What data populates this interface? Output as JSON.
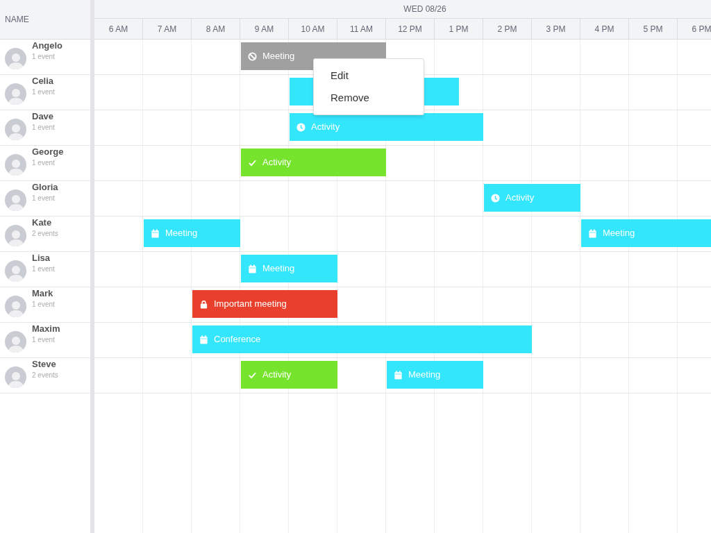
{
  "header": {
    "name_column": "NAME",
    "date": "WED 08/26",
    "hours": [
      "6 AM",
      "7 AM",
      "8 AM",
      "9 AM",
      "10 AM",
      "11 AM",
      "12 PM",
      "1 PM",
      "2 PM",
      "3 PM",
      "4 PM",
      "5 PM",
      "6 PM"
    ]
  },
  "resources": [
    {
      "name": "Angelo",
      "count": "1 event",
      "events": [
        {
          "label": "Meeting",
          "kind": "blocked",
          "color": "#a0a0a0"
        }
      ]
    },
    {
      "name": "Celia",
      "count": "1 event",
      "events": [
        {
          "kind": "hidden",
          "color": "#33e6fc"
        }
      ]
    },
    {
      "name": "Dave",
      "count": "1 event",
      "events": [
        {
          "label": "Activity",
          "kind": "clock",
          "color": "#33e6fc"
        }
      ]
    },
    {
      "name": "George",
      "count": "1 event",
      "events": [
        {
          "label": "Activity",
          "kind": "check",
          "color": "#76e42c"
        }
      ]
    },
    {
      "name": "Gloria",
      "count": "1 event",
      "events": [
        {
          "label": "Activity",
          "kind": "clock",
          "color": "#33e6fc"
        }
      ]
    },
    {
      "name": "Kate",
      "count": "2 events",
      "events": [
        {
          "label": "Meeting",
          "kind": "calendar",
          "color": "#33e6fc"
        },
        {
          "label": "Meeting",
          "kind": "calendar",
          "color": "#33e6fc"
        }
      ]
    },
    {
      "name": "Lisa",
      "count": "1 event",
      "events": [
        {
          "label": "Meeting",
          "kind": "calendar",
          "color": "#33e6fc"
        }
      ]
    },
    {
      "name": "Mark",
      "count": "1 event",
      "events": [
        {
          "label": "Important meeting",
          "kind": "lock",
          "color": "#e8402c"
        }
      ]
    },
    {
      "name": "Maxim",
      "count": "1 event",
      "events": [
        {
          "label": "Conference",
          "kind": "calendar",
          "color": "#33e6fc"
        }
      ]
    },
    {
      "name": "Steve",
      "count": "2 events",
      "events": [
        {
          "label": "Activity",
          "kind": "check",
          "color": "#76e42c"
        },
        {
          "label": "Meeting",
          "kind": "calendar",
          "color": "#33e6fc"
        }
      ]
    }
  ],
  "context_menu": {
    "items": [
      "Edit",
      "Remove"
    ]
  }
}
